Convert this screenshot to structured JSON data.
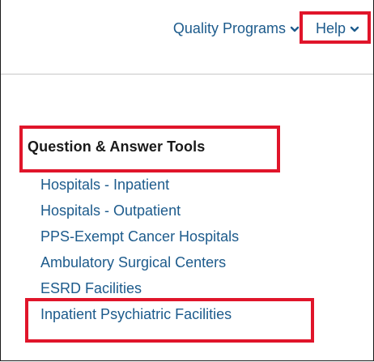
{
  "nav": {
    "quality_programs_label": "Quality Programs",
    "help_label": "Help",
    "chevron_icon": "chevron-down-icon"
  },
  "qa": {
    "title": "Question & Answer Tools",
    "links": [
      "Hospitals - Inpatient",
      "Hospitals - Outpatient",
      "PPS-Exempt Cancer Hospitals",
      "Ambulatory Surgical Centers",
      "ESRD Facilities",
      "Inpatient Psychiatric Facilities"
    ]
  },
  "colors": {
    "link": "#1d5b8c",
    "highlight": "#e0152a",
    "text": "#1a1a1a"
  }
}
